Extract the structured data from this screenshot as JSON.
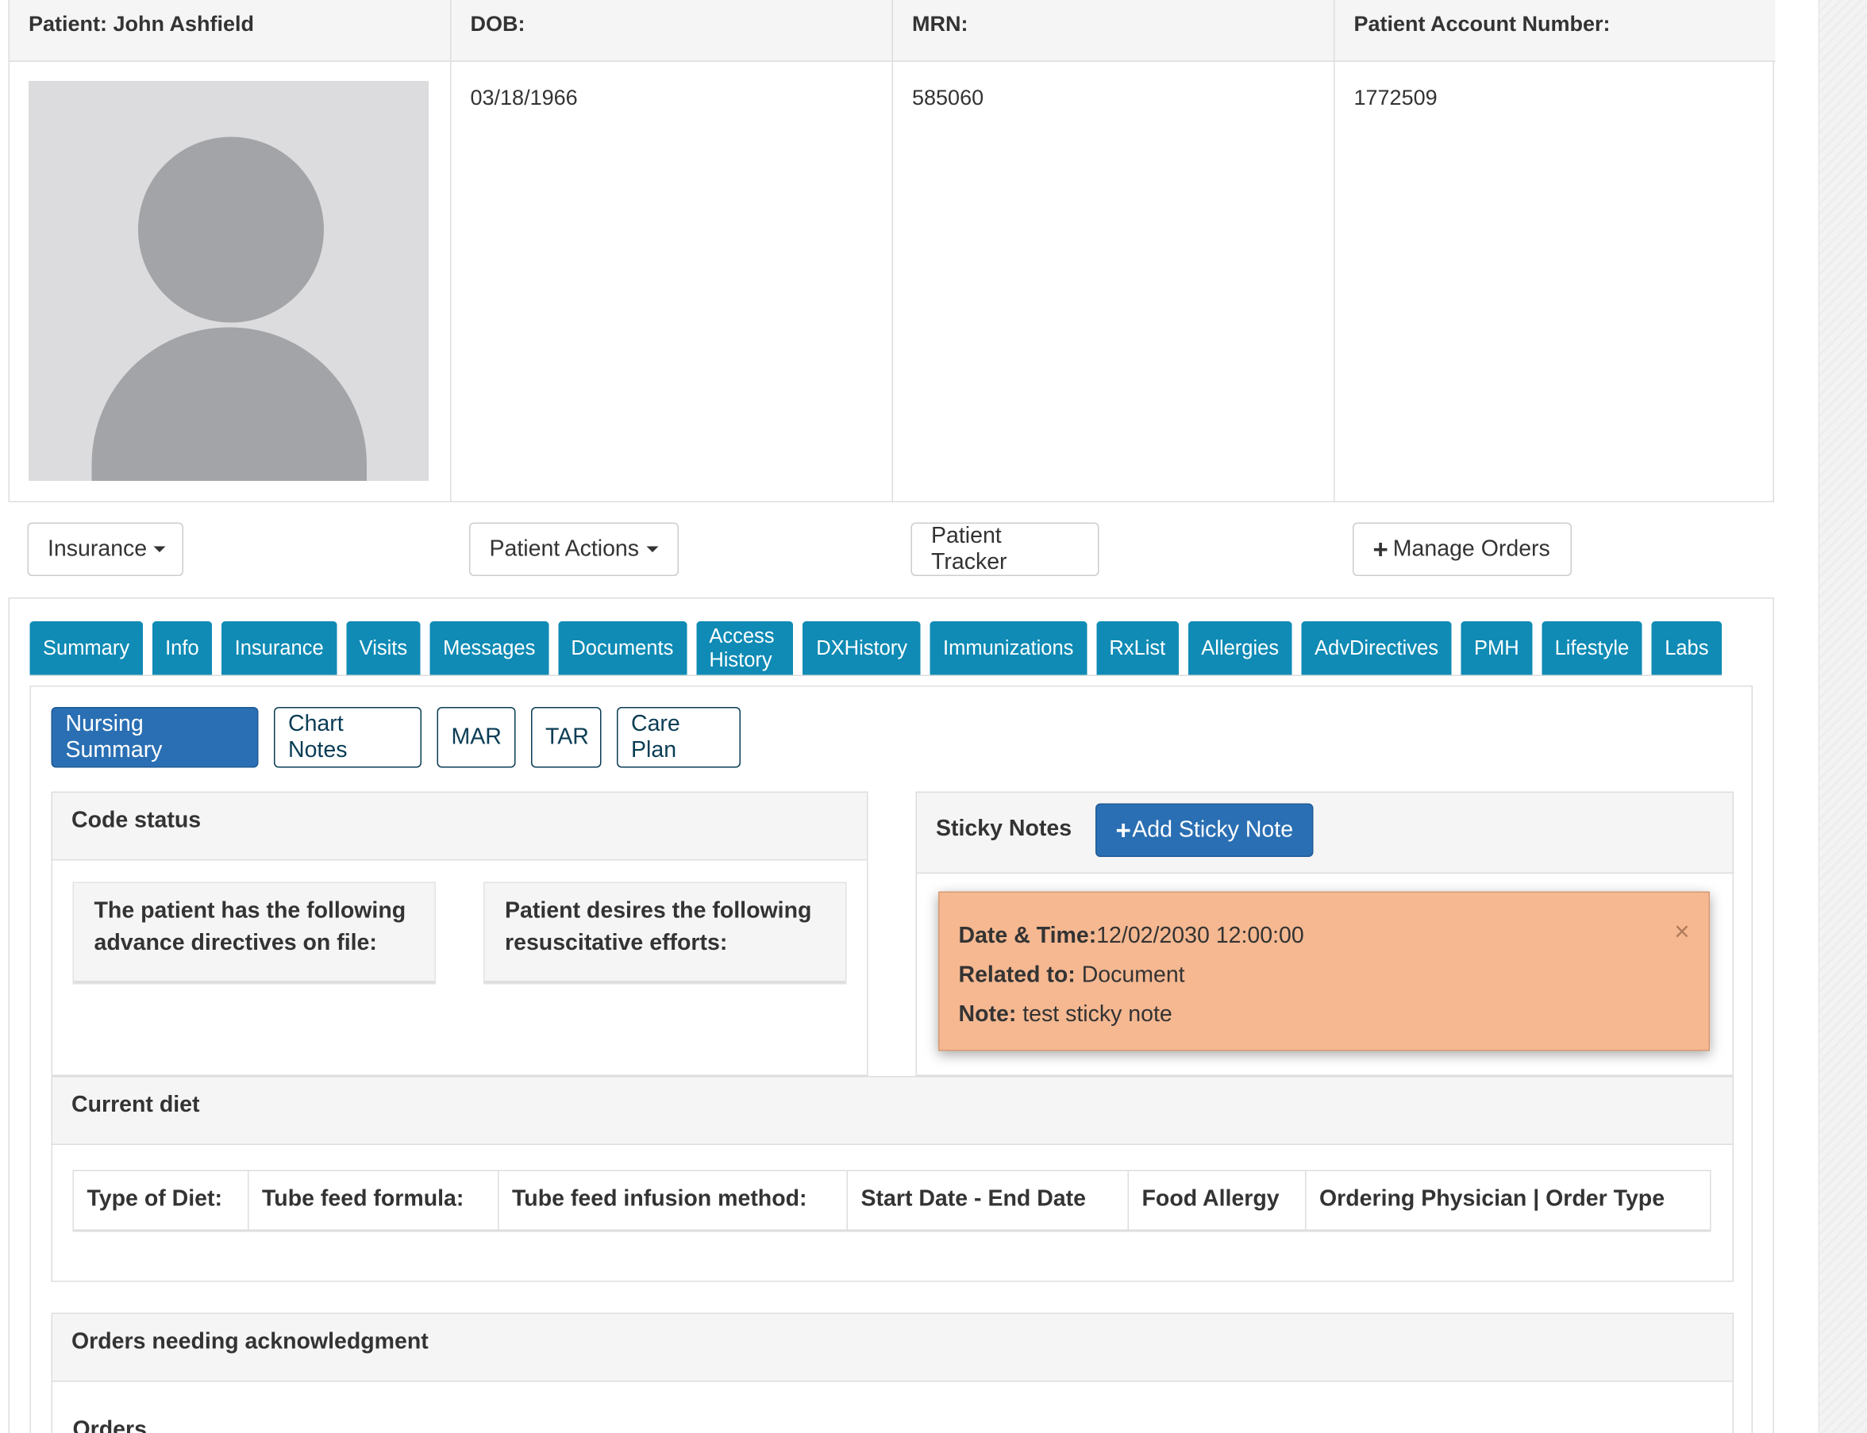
{
  "patient": {
    "headers": {
      "patient": "Patient: John Ashfield",
      "dob": "DOB:",
      "mrn": "MRN:",
      "account": "Patient Account Number:"
    },
    "dob": "03/18/1966",
    "mrn": "585060",
    "account_number": "1772509"
  },
  "actions": {
    "insurance": "Insurance",
    "patient_actions": "Patient Actions",
    "patient_tracker": "Patient Tracker",
    "manage_orders": "Manage Orders"
  },
  "tabs": [
    "Summary",
    "Info",
    "Insurance",
    "Visits",
    "Messages",
    "Documents",
    "Access History",
    "DXHistory",
    "Immunizations",
    "RxList",
    "Allergies",
    "AdvDirectives",
    "PMH",
    "Lifestyle",
    "Labs"
  ],
  "subtabs": {
    "nursing_summary": "Nursing Summary",
    "chart_notes": "Chart Notes",
    "mar": "MAR",
    "tar": "TAR",
    "care_plan": "Care Plan"
  },
  "code_status": {
    "title": "Code status",
    "directives": "The patient has the following advance directives on file:",
    "resuscitative": "Patient desires the following resuscitative efforts:"
  },
  "sticky_notes": {
    "title": "Sticky Notes",
    "add_button": "Add Sticky Note",
    "note": {
      "datetime_label": "Date & Time:",
      "datetime": "12/02/2030 12:00:00",
      "related_label": "Related to:",
      "related": "Document",
      "note_label": "Note:",
      "note": "test sticky note",
      "close": "×"
    }
  },
  "current_diet": {
    "title": "Current diet",
    "columns": [
      "Type of Diet:",
      "Tube feed formula:",
      "Tube feed infusion method:",
      "Start Date - End Date",
      "Food Allergy",
      "Ordering Physician | Order Type"
    ]
  },
  "orders": {
    "title": "Orders needing acknowledgment",
    "label": "Orders"
  }
}
